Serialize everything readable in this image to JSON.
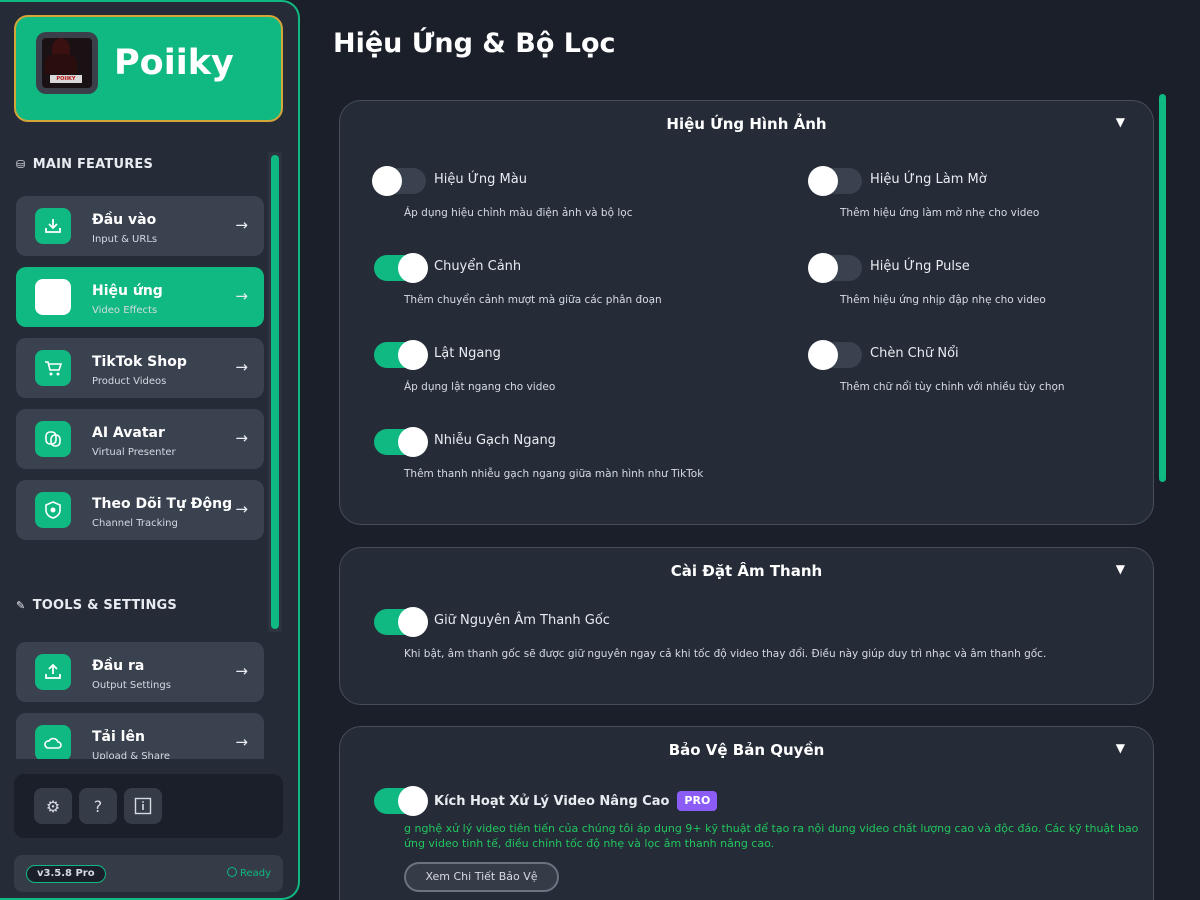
{
  "app": {
    "name": "Poiiky",
    "logo_tag": "POIIKY",
    "accent_color": "#10b981"
  },
  "sidebar": {
    "sections": {
      "main": "MAIN FEATURES",
      "tools": "TOOLS & SETTINGS"
    },
    "main_items": [
      {
        "label": "Đầu vào",
        "sub": "Input & URLs",
        "icon": "input-tray-icon",
        "active": false
      },
      {
        "label": "Hiệu ứng",
        "sub": "Video Effects",
        "icon": "effects-icon",
        "active": true
      },
      {
        "label": "TikTok Shop",
        "sub": "Product Videos",
        "icon": "shopping-cart-icon",
        "active": false
      },
      {
        "label": "AI Avatar",
        "sub": "Virtual Presenter",
        "icon": "masks-icon",
        "active": false
      },
      {
        "label": "Theo Dõi Tự Động",
        "sub": "Channel Tracking",
        "icon": "shield-tracking-icon",
        "active": false
      }
    ],
    "tool_items": [
      {
        "label": "Đầu ra",
        "sub": "Output Settings",
        "icon": "output-tray-icon"
      },
      {
        "label": "Tải lên",
        "sub": "Upload & Share",
        "icon": "cloud-icon"
      }
    ],
    "arrow": "→",
    "bottom_buttons": [
      "settings-icon",
      "help-icon",
      "info-icon"
    ],
    "version": "v3.5.8 Pro",
    "status": "Ready"
  },
  "main": {
    "title": "Hiệu Ứng & Bộ Lọc",
    "visual_effects": {
      "title": "Hiệu Ứng Hình Ảnh",
      "caret": "▼",
      "options": [
        {
          "label": "Hiệu Ứng Màu",
          "desc": "Áp dụng hiệu chỉnh màu điện ảnh và bộ lọc",
          "on": false
        },
        {
          "label": "Hiệu Ứng Làm Mờ",
          "desc": "Thêm hiệu ứng làm mờ nhẹ cho video",
          "on": false
        },
        {
          "label": "Chuyển Cảnh",
          "desc": "Thêm chuyển cảnh mượt mà giữa các phân đoạn",
          "on": true
        },
        {
          "label": "Hiệu Ứng Pulse",
          "desc": "Thêm hiệu ứng nhịp đập nhẹ cho video",
          "on": false
        },
        {
          "label": "Lật Ngang",
          "desc": "Áp dụng lật ngang cho video",
          "on": true
        },
        {
          "label": "Chèn Chữ Nổi",
          "desc": "Thêm chữ nổi tùy chỉnh với nhiều tùy chọn",
          "on": false
        },
        {
          "label": "Nhiễu Gạch Ngang",
          "desc": "Thêm thanh nhiễu gạch ngang giữa màn hình như TikTok",
          "on": true
        }
      ]
    },
    "audio": {
      "title": "Cài Đặt Âm Thanh",
      "caret": "▼",
      "option": {
        "label": "Giữ Nguyên Âm Thanh Gốc",
        "desc": "Khi bật, âm thanh gốc sẽ được giữ nguyên ngay cả khi tốc độ video thay đổi. Điều này giúp duy trì nhạc và âm thanh gốc.",
        "on": true
      }
    },
    "copyright": {
      "title": "Bảo Vệ Bản Quyền",
      "caret": "▼",
      "option": {
        "label": "Kích Hoạt Xử Lý Video Nâng Cao",
        "badge": "PRO",
        "on": true
      },
      "desc_line1": "g nghệ xử lý video tiên tiến của chúng tôi áp dụng 9+ kỹ thuật để tạo ra nội dung video chất lượng cao và độc đáo. Các kỹ thuật bao",
      "desc_line2": "ứng video tinh tế, điều chỉnh tốc độ nhẹ và lọc âm thanh nâng cao.",
      "detail_button": "Xem Chi Tiết Bảo Vệ"
    }
  }
}
